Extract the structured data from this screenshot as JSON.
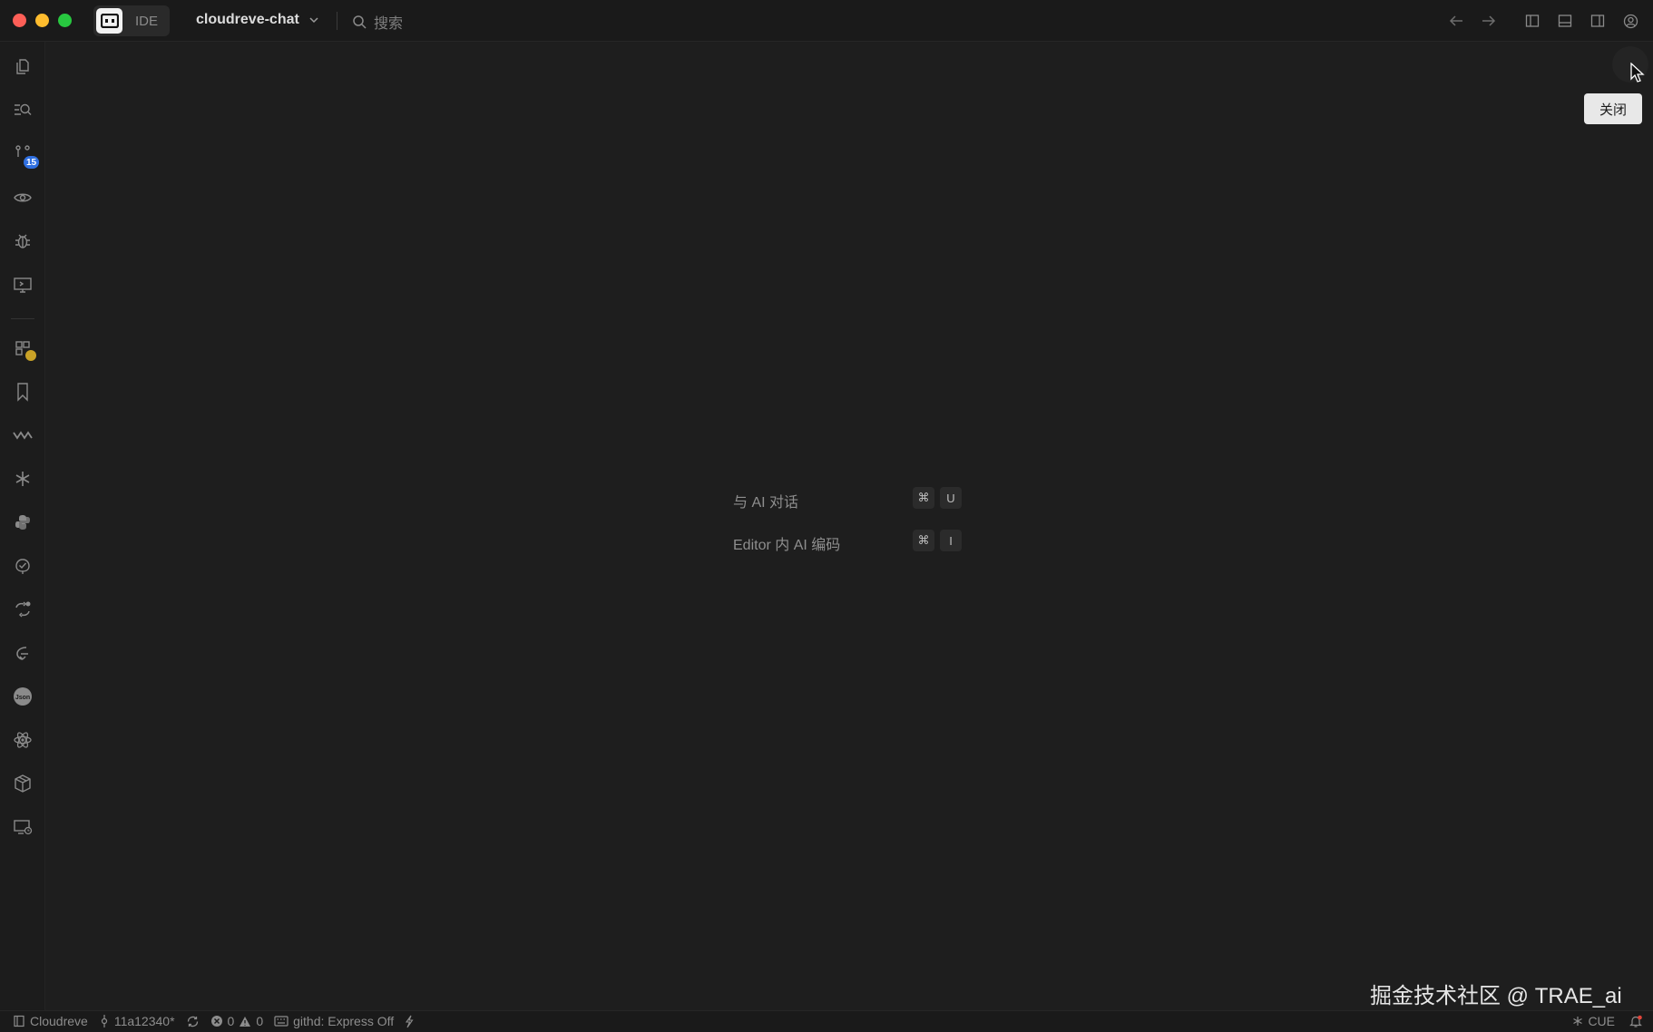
{
  "titlebar": {
    "ide_label": "IDE",
    "project_name": "cloudreve-chat",
    "search_placeholder": "搜索"
  },
  "activity_bar": {
    "source_control_badge": "15",
    "icons": [
      "explorer-icon",
      "search-icon",
      "source-control-icon",
      "eye-icon",
      "debug-icon",
      "remote-display-icon",
      "extensions-icon",
      "bookmark-icon",
      "wave-icon",
      "asterisk-icon",
      "python-icon",
      "check-leaf-icon",
      "sync-icon",
      "rocket-icon",
      "json-icon",
      "react-atom-icon",
      "package-icon",
      "remote-explorer-icon"
    ]
  },
  "editor": {
    "tooltip": "关闭",
    "shortcuts": [
      {
        "label": "与 AI 对话",
        "key1": "⌘",
        "key2": "U"
      },
      {
        "label": "Editor 内 AI 编码",
        "key1": "⌘",
        "key2": "I"
      }
    ],
    "watermark": "掘金技术社区 @ TRAE_ai"
  },
  "statusbar": {
    "workspace": "Cloudreve",
    "branch": "11a12340*",
    "errors": "0",
    "warnings": "0",
    "githd": "githd: Express Off",
    "language": "CUE"
  },
  "colors": {
    "background": "#1e1e1e",
    "badge": "#2f6fe0",
    "traffic_red": "#fe5f57",
    "traffic_yellow": "#febc2e",
    "traffic_green": "#28c840"
  }
}
